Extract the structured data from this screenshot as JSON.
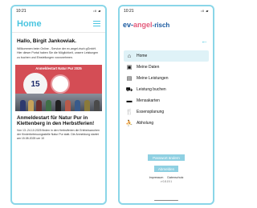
{
  "left": {
    "status_time": "10:21",
    "status_icons": "ıll ▰",
    "header_title": "Home",
    "greeting": "Hallo, Birgit Jankowiak.",
    "welcome_text": "Willkommen beim Online - Service der ev-angel-risch gGmbH. Hier dieser Portal haben Sie die Möglichkeit, unsere Leistungen zu buchen und Einstellungen vorzunehmen.",
    "banner_caption": "Anmeldestart Natur Pur 2025",
    "banner_logo_text": "15",
    "article_title": "Anmeldestart für Natur Pur in Klettenberg in den Herbstferien!",
    "article_body": "Von 13.-24.10.2025 finden in den Herbstferien die Erlebniswochen der Kinderbetreuungsstelle Natur Pur statt. Die Anmeldung startet am 15.08.2025 um 10"
  },
  "right": {
    "status_time": "10:21",
    "status_icons": "ıll ▰",
    "brand_part1": "ev-",
    "brand_part2": "angel",
    "brand_part3": "-risch",
    "back_arrow": "←",
    "menu": [
      {
        "label": "Home",
        "icon": "home-icon",
        "glyph": "⌂",
        "active": true
      },
      {
        "label": "Meine Daten",
        "icon": "id-card-icon",
        "glyph": "▣",
        "active": false
      },
      {
        "label": "Meine Leistungen",
        "icon": "list-icon",
        "glyph": "▤",
        "active": false
      },
      {
        "label": "Leistung buchen",
        "icon": "cart-icon",
        "glyph": "⛟",
        "active": false
      },
      {
        "label": "Mensakarten",
        "icon": "card-icon",
        "glyph": "▬",
        "active": false
      },
      {
        "label": "Essensplanung",
        "icon": "cutlery-icon",
        "glyph": "🍴",
        "active": false
      },
      {
        "label": "Abholung",
        "icon": "pickup-icon",
        "glyph": "⛹",
        "active": false
      }
    ],
    "password_button": "Passwort ändern",
    "logout_button": "Abmelden",
    "legal_impressum": "Impressum",
    "legal_datenschutz": "Datenschutz",
    "version": "v 0.8.19.1"
  },
  "colors": {
    "accent": "#49c5e0",
    "frame": "#8ad6e8",
    "banner": "#d44d55",
    "button": "#8fd0e2",
    "brand_blue": "#1a5aa0",
    "brand_pink": "#e35a7a"
  }
}
